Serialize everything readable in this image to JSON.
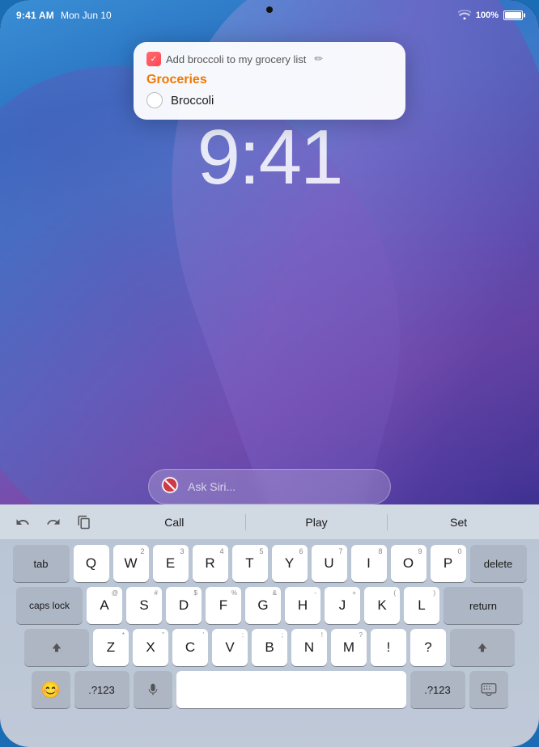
{
  "device": {
    "top_dot": true
  },
  "status_bar": {
    "time": "9:41 AM",
    "date": "Mon Jun 10",
    "wifi": "WiFi",
    "battery_percent": "100%"
  },
  "notification": {
    "subtitle": "Add broccoli to my grocery list",
    "edit_icon": "✏",
    "list_title": "Groceries",
    "items": [
      {
        "label": "Broccoli",
        "checked": false
      }
    ]
  },
  "lock_time": "9:41",
  "siri": {
    "placeholder": "Ask Siri..."
  },
  "keyboard": {
    "toolbar": {
      "undo_label": "↩",
      "redo_label": "↪",
      "copy_label": "⧉",
      "suggestions": [
        "Call",
        "Play",
        "Set"
      ]
    },
    "rows": [
      {
        "keys": [
          {
            "label": "tab",
            "wide": true,
            "class": "key-tab"
          },
          {
            "label": "Q",
            "sub": "",
            "class": "key-letter"
          },
          {
            "label": "W",
            "sub": "2",
            "class": "key-letter"
          },
          {
            "label": "E",
            "sub": "3",
            "class": "key-letter"
          },
          {
            "label": "R",
            "sub": "4",
            "class": "key-letter"
          },
          {
            "label": "T",
            "sub": "5",
            "class": "key-letter"
          },
          {
            "label": "Y",
            "sub": "6",
            "class": "key-letter"
          },
          {
            "label": "U",
            "sub": "7",
            "class": "key-letter"
          },
          {
            "label": "I",
            "sub": "8",
            "class": "key-letter"
          },
          {
            "label": "O",
            "sub": "9",
            "class": "key-letter"
          },
          {
            "label": "P",
            "sub": "0",
            "class": "key-letter"
          },
          {
            "label": "delete",
            "wide": true,
            "class": "key-delete"
          }
        ]
      },
      {
        "keys": [
          {
            "label": "caps lock",
            "wide": true,
            "class": "key-caps"
          },
          {
            "label": "A",
            "sub": "@",
            "class": "key-letter"
          },
          {
            "label": "S",
            "sub": "#",
            "class": "key-letter"
          },
          {
            "label": "D",
            "sub": "$",
            "class": "key-letter"
          },
          {
            "label": "F",
            "sub": "%",
            "class": "key-letter"
          },
          {
            "label": "G",
            "sub": "&",
            "class": "key-letter"
          },
          {
            "label": "H",
            "sub": "-",
            "class": "key-letter"
          },
          {
            "label": "J",
            "sub": "+",
            "class": "key-letter"
          },
          {
            "label": "K",
            "sub": "(",
            "class": "key-letter"
          },
          {
            "label": "L",
            "sub": ")",
            "class": "key-letter"
          },
          {
            "label": "return",
            "wide": true,
            "class": "key-return"
          }
        ]
      },
      {
        "keys": [
          {
            "label": "shift",
            "wide": true,
            "class": "key-shift"
          },
          {
            "label": "Z",
            "sub": "*",
            "class": "key-letter"
          },
          {
            "label": "X",
            "sub": "\"",
            "class": "key-letter"
          },
          {
            "label": "C",
            "sub": "'",
            "class": "key-letter"
          },
          {
            "label": "V",
            "sub": ":",
            "class": "key-letter"
          },
          {
            "label": "B",
            "sub": ";",
            "class": "key-letter"
          },
          {
            "label": "N",
            "sub": "!",
            "class": "key-letter"
          },
          {
            "label": "M",
            "sub": "?",
            "class": "key-letter"
          },
          {
            "label": "!",
            "sub": "",
            "class": "key-letter"
          },
          {
            "label": "?",
            "sub": "",
            "class": "key-letter"
          },
          {
            "label": "shift",
            "wide": true,
            "class": "key-shift-r"
          }
        ]
      },
      {
        "keys": [
          {
            "label": "😊",
            "wide": false,
            "class": "key-emoji"
          },
          {
            "label": ".?123",
            "wide": true,
            "class": "key-numbers"
          },
          {
            "label": "🎤",
            "wide": false,
            "class": "key-mic"
          },
          {
            "label": "",
            "wide": false,
            "class": "key-space",
            "isSpace": true
          },
          {
            "label": ".?123",
            "wide": true,
            "class": "key-numbers-r"
          },
          {
            "label": "⌨",
            "wide": false,
            "class": "key-keyboard"
          }
        ]
      }
    ]
  }
}
